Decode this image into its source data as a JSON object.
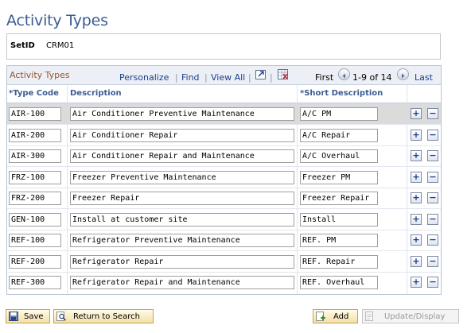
{
  "page": {
    "title": "Activity Types"
  },
  "setid": {
    "label": "SetID",
    "value": "CRM01"
  },
  "grid": {
    "title": "Activity Types",
    "personalize": "Personalize",
    "find": "Find",
    "view_all": "View All",
    "sep": "|",
    "first": "First",
    "range": "1-9 of 14",
    "last": "Last",
    "columns": {
      "type_code": "*Type Code",
      "description": "Description",
      "short_description": "*Short Description"
    },
    "add_glyph": "+",
    "delete_glyph": "−",
    "rows": [
      {
        "code": "AIR-100",
        "description": "Air Conditioner Preventive Maintenance",
        "short": "A/C PM"
      },
      {
        "code": "AIR-200",
        "description": "Air Conditioner Repair",
        "short": "A/C Repair"
      },
      {
        "code": "AIR-300",
        "description": "Air Conditioner Repair and Maintenance",
        "short": "A/C Overhaul"
      },
      {
        "code": "FRZ-100",
        "description": "Freezer Preventive Maintenance",
        "short": "Freezer PM"
      },
      {
        "code": "FRZ-200",
        "description": "Freezer Repair",
        "short": "Freezer Repair"
      },
      {
        "code": "GEN-100",
        "description": "Install at customer site",
        "short": "Install"
      },
      {
        "code": "REF-100",
        "description": "Refrigerator Preventive Maintenance",
        "short": "REF. PM"
      },
      {
        "code": "REF-200",
        "description": "Refrigerator Repair",
        "short": "REF. Repair"
      },
      {
        "code": "REF-300",
        "description": "Refrigerator Repair and Maintenance",
        "short": "REF. Overhaul"
      }
    ]
  },
  "toolbar": {
    "save": "Save",
    "return_to_search": "Return to Search",
    "add": "Add",
    "update_display": "Update/Display"
  },
  "colors": {
    "title": "#3c5c93",
    "grid_title": "#a0522d",
    "link": "#1a3d8c",
    "selected_row": "#dbdbdb"
  },
  "icons": [
    "zoom-icon",
    "download-icon",
    "first-arrow-icon",
    "next-arrow-icon",
    "save-icon",
    "search-return-icon",
    "add-icon",
    "update-icon"
  ]
}
